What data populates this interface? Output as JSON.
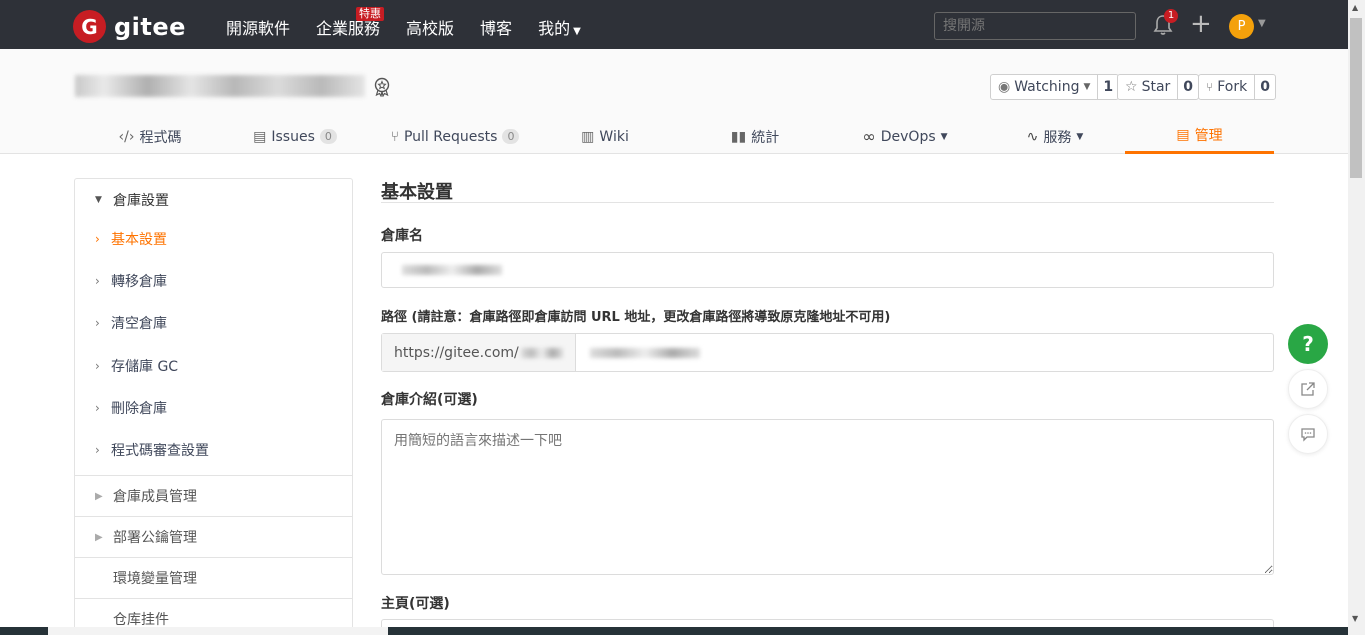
{
  "nav": {
    "logo_letter": "G",
    "logo_text": "gitee",
    "links": [
      "開源軟件",
      "企業服務",
      "高校版",
      "博客",
      "我的"
    ],
    "promo_badge": "特惠",
    "search_placeholder": "搜開源",
    "notification_count": "1",
    "avatar_letter": "P"
  },
  "project": {
    "watch_label": "Watching",
    "watch_count": "1",
    "star_label": "Star",
    "star_count": "0",
    "fork_label": "Fork",
    "fork_count": "0"
  },
  "tabs": [
    {
      "label": "程式碼",
      "icon": "code-icon"
    },
    {
      "label": "Issues",
      "icon": "issues-icon",
      "count": "0"
    },
    {
      "label": "Pull Requests",
      "icon": "pull-request-icon",
      "count": "0"
    },
    {
      "label": "Wiki",
      "icon": "wiki-icon"
    },
    {
      "label": "統計",
      "icon": "stats-icon"
    },
    {
      "label": "DevOps",
      "icon": "devops-icon"
    },
    {
      "label": "服務",
      "icon": "service-icon"
    },
    {
      "label": "管理",
      "icon": "manage-icon",
      "active": true
    }
  ],
  "sidebar": {
    "group_title": "倉庫設置",
    "items": [
      "基本設置",
      "轉移倉庫",
      "清空倉庫",
      "存儲庫 GC",
      "刪除倉庫",
      "程式碼審查設置"
    ],
    "active_index": 0,
    "sections": [
      "倉庫成員管理",
      "部署公鑰管理",
      "環境變量管理",
      "仓库挂件"
    ]
  },
  "form": {
    "title": "基本設置",
    "repo_name_label": "倉庫名",
    "path_label": "路徑 (請註意：倉庫路徑即倉庫訪問 URL 地址，更改倉庫路徑將導致原克隆地址不可用)",
    "path_prefix": "https://gitee.com/",
    "description_label": "倉庫介紹(可選)",
    "description_placeholder": "用簡短的語言來描述一下吧",
    "homepage_label": "主頁(可選)"
  },
  "colors": {
    "accent": "#fe7300",
    "nav_bg": "#2e3138",
    "brand_red": "#c71d23",
    "help_green": "#29a745"
  }
}
